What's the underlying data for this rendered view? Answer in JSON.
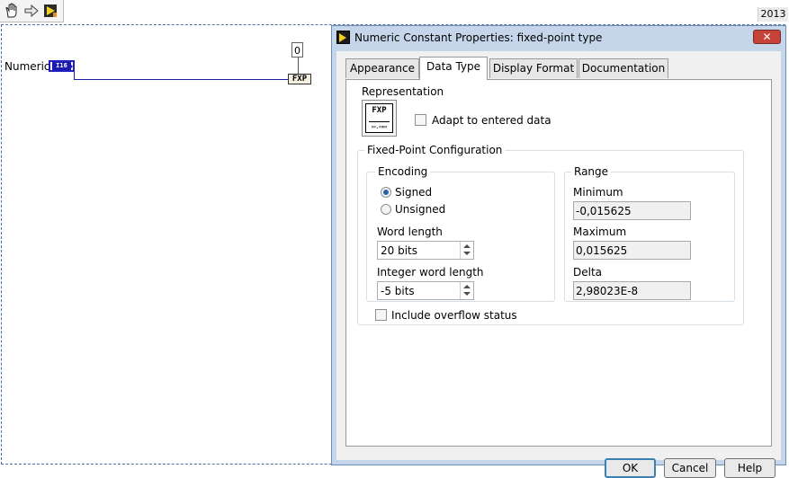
{
  "version_label": "2013",
  "toolbar": {
    "icons": [
      "hand-tool-icon",
      "arrow-right-icon",
      "run-arrow-icon"
    ]
  },
  "diagram": {
    "numeric_label": "Numeric",
    "numeric_type": "I16",
    "constant_value": "0",
    "fxp_node_label": "FXP"
  },
  "dialog": {
    "title": "Numeric Constant Properties: fixed-point type",
    "close_label": "✕",
    "tabs": [
      {
        "label": "Appearance",
        "active": false
      },
      {
        "label": "Data Type",
        "active": true
      },
      {
        "label": "Display Format",
        "active": false
      },
      {
        "label": "Documentation",
        "active": false
      }
    ],
    "representation": {
      "label": "Representation",
      "icon_text": "FXP",
      "icon_dots": "▭.▭▭"
    },
    "adapt_checkbox": {
      "label": "Adapt to entered data",
      "checked": false
    },
    "fixed_point": {
      "title": "Fixed-Point Configuration",
      "encoding": {
        "title": "Encoding",
        "options": [
          {
            "label": "Signed",
            "selected": true
          },
          {
            "label": "Unsigned",
            "selected": false
          }
        ],
        "word_length_label": "Word length",
        "word_length_value": "20 bits",
        "integer_word_length_label": "Integer word length",
        "integer_word_length_value": "-5 bits"
      },
      "range": {
        "title": "Range",
        "minimum_label": "Minimum",
        "minimum_value": "-0,015625",
        "maximum_label": "Maximum",
        "maximum_value": "0,015625",
        "delta_label": "Delta",
        "delta_value": "2,98023E-8"
      }
    },
    "overflow_checkbox": {
      "label": "Include overflow status",
      "checked": false
    },
    "buttons": {
      "ok": "OK",
      "cancel": "Cancel",
      "help": "Help"
    }
  }
}
